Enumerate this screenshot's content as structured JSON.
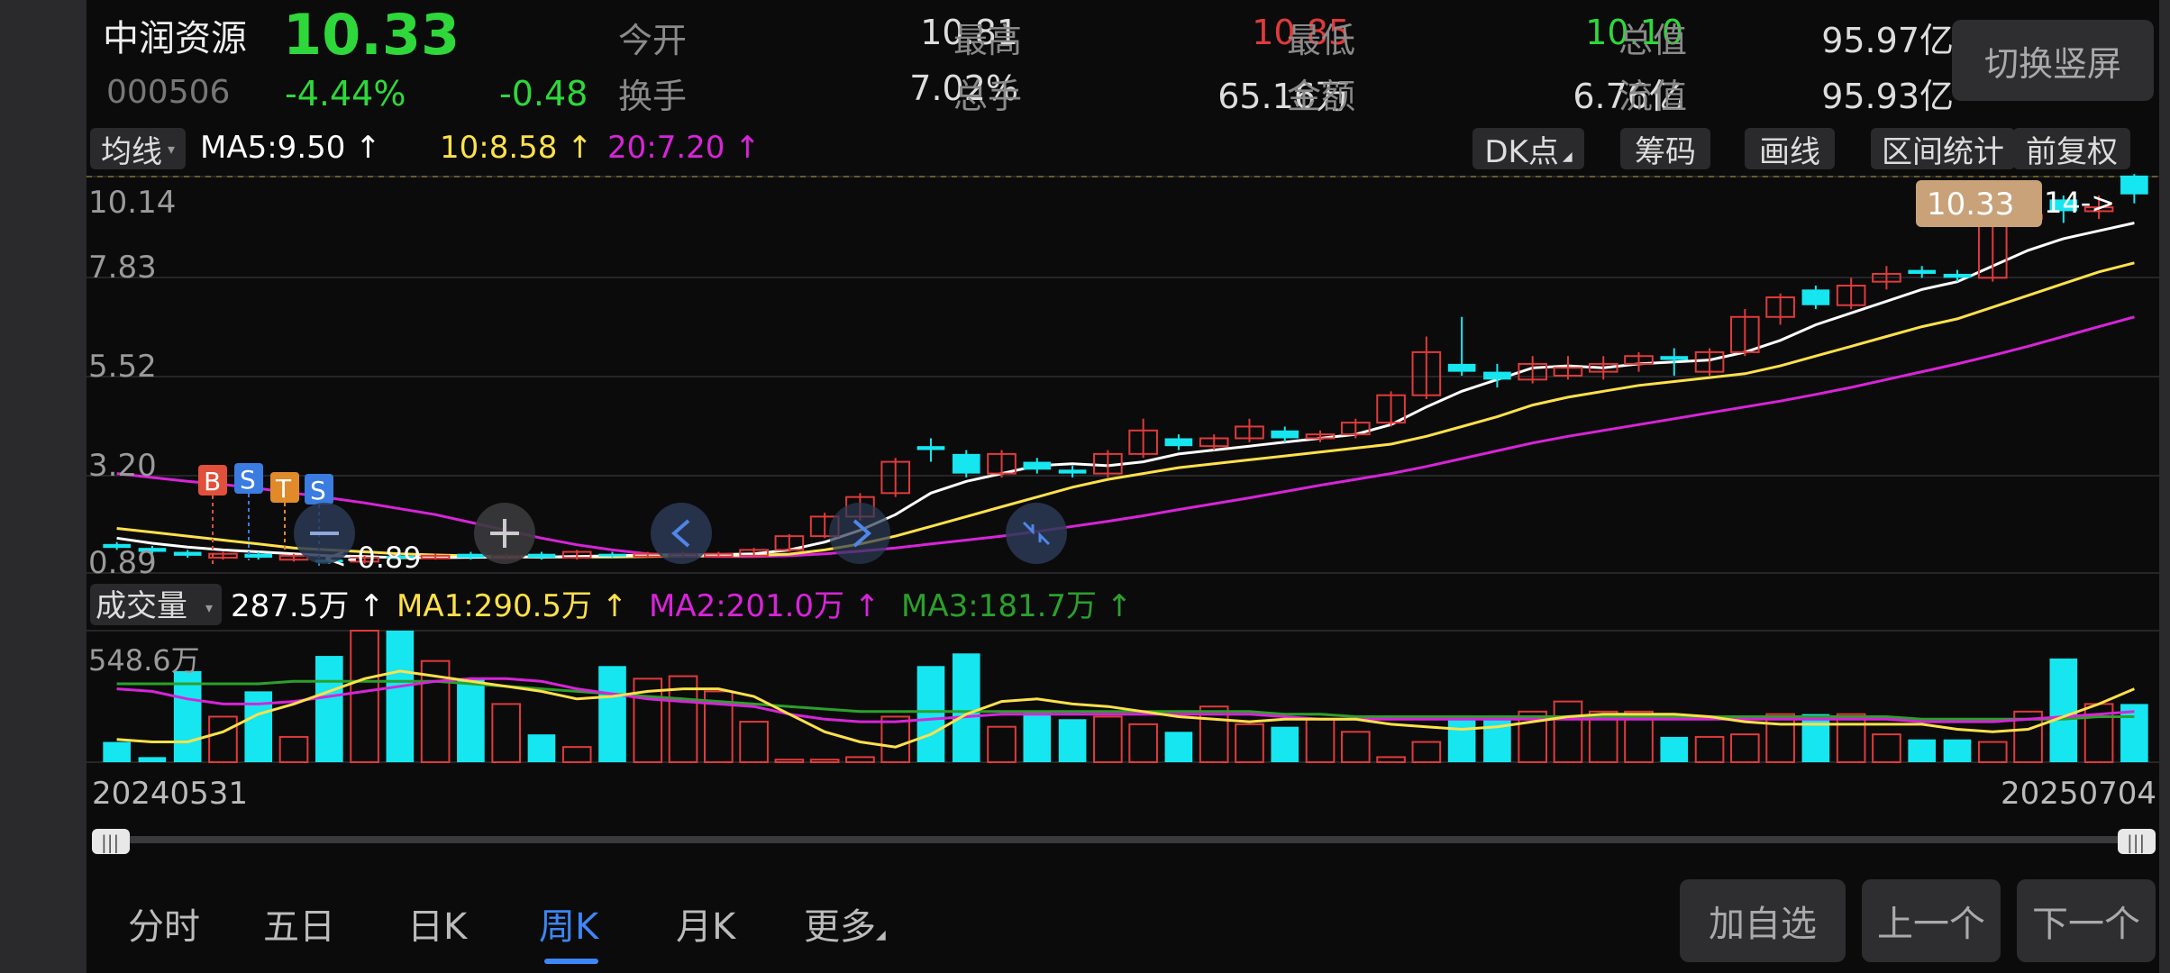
{
  "header": {
    "name": "中润资源",
    "code": "000506",
    "price": "10.33",
    "change_pct": "-4.44%",
    "change_abs": "-0.48",
    "stats": [
      {
        "label": "今开",
        "value": "10.81"
      },
      {
        "label": "最高",
        "value": "10.85"
      },
      {
        "label": "最低",
        "value": "10.10"
      },
      {
        "label": "总值",
        "value": "95.97亿"
      },
      {
        "label": "换手",
        "value": "7.02%"
      },
      {
        "label": "总手",
        "value": "65.16万"
      },
      {
        "label": "金额",
        "value": "6.76亿"
      },
      {
        "label": "流值",
        "value": "95.93亿"
      }
    ],
    "switch_label": "切换竖屏"
  },
  "toolbar": {
    "ma_selector": "均线",
    "ma5": "MA5:9.50 ↑",
    "ma10": "10:8.58 ↑",
    "ma20": "20:7.20 ↑",
    "buttons": [
      "DK点",
      "筹码",
      "画线",
      "区间统计",
      "前复权"
    ]
  },
  "colors": {
    "up": "#e03a3a",
    "down": "#16e6f0",
    "ma5": "#ffffff",
    "ma10": "#ffe14a",
    "ma20": "#d824d8",
    "vol_ma3": "#2ca02c",
    "accent": "#3d86f5",
    "price_green": "#2ed83a"
  },
  "price_axis": {
    "ticks": [
      "10.14",
      "7.83",
      "5.52",
      "3.20",
      "0.89"
    ]
  },
  "price_tag": "10.33",
  "max_marker": "14->",
  "min_marker": "<-0.89",
  "trade_markers": [
    "B",
    "S",
    "T",
    "S"
  ],
  "chart_controls": [
    "minus-icon",
    "plus-icon",
    "chevron-left-icon",
    "chevron-right-icon",
    "compress-icon"
  ],
  "volume": {
    "selector": "成交量",
    "current": "287.5万 ↑",
    "ma1": "MA1:290.5万 ↑",
    "ma2": "MA2:201.0万 ↑",
    "ma3": "MA3:181.7万 ↑",
    "axis_top": "548.6万"
  },
  "dates": {
    "start": "20240531",
    "end": "20250704"
  },
  "tabs": [
    {
      "label": "分时"
    },
    {
      "label": "五日"
    },
    {
      "label": "日K"
    },
    {
      "label": "周K",
      "active": true
    },
    {
      "label": "月K"
    },
    {
      "label": "更多"
    }
  ],
  "actions": [
    "加自选",
    "上一个",
    "下一个"
  ],
  "chart_data": {
    "type": "candlestick",
    "price_range": [
      0.89,
      10.14
    ],
    "candles": [
      [
        1.4,
        1.3,
        1.45,
        1.25
      ],
      [
        1.3,
        1.2,
        1.35,
        1.15
      ],
      [
        1.2,
        1.1,
        1.25,
        1.05
      ],
      [
        1.05,
        1.15,
        1.2,
        1.0
      ],
      [
        1.15,
        1.05,
        1.2,
        1.0
      ],
      [
        1.0,
        1.1,
        1.15,
        0.95
      ],
      [
        1.0,
        0.95,
        1.1,
        0.89
      ],
      [
        0.95,
        1.05,
        1.1,
        0.9
      ],
      [
        1.1,
        1.05,
        1.15,
        1.0
      ],
      [
        1.05,
        1.1,
        1.15,
        1.0
      ],
      [
        1.15,
        1.05,
        1.2,
        1.0
      ],
      [
        1.05,
        1.1,
        1.15,
        1.0
      ],
      [
        1.15,
        1.05,
        1.2,
        1.0
      ],
      [
        1.05,
        1.2,
        1.25,
        1.0
      ],
      [
        1.15,
        1.1,
        1.2,
        1.05
      ],
      [
        1.1,
        1.15,
        1.2,
        1.05
      ],
      [
        1.1,
        1.15,
        1.2,
        1.05
      ],
      [
        1.1,
        1.15,
        1.2,
        1.05
      ],
      [
        1.1,
        1.25,
        1.3,
        1.05
      ],
      [
        1.25,
        1.6,
        1.65,
        1.2
      ],
      [
        1.6,
        2.1,
        2.2,
        1.55
      ],
      [
        2.1,
        2.6,
        2.7,
        2.0
      ],
      [
        2.7,
        3.5,
        3.6,
        2.6
      ],
      [
        3.9,
        3.8,
        4.1,
        3.5
      ],
      [
        3.7,
        3.2,
        3.8,
        3.1
      ],
      [
        3.2,
        3.7,
        3.8,
        3.1
      ],
      [
        3.5,
        3.3,
        3.6,
        3.2
      ],
      [
        3.3,
        3.2,
        3.4,
        3.1
      ],
      [
        3.2,
        3.7,
        3.8,
        3.1
      ],
      [
        3.7,
        4.3,
        4.6,
        3.6
      ],
      [
        4.1,
        3.9,
        4.2,
        3.8
      ],
      [
        3.9,
        4.1,
        4.2,
        3.8
      ],
      [
        4.1,
        4.4,
        4.6,
        4.0
      ],
      [
        4.3,
        4.1,
        4.4,
        4.0
      ],
      [
        4.1,
        4.2,
        4.3,
        4.0
      ],
      [
        4.2,
        4.5,
        4.6,
        4.1
      ],
      [
        4.5,
        5.2,
        5.3,
        4.4
      ],
      [
        5.2,
        6.3,
        6.7,
        5.1
      ],
      [
        6.0,
        5.8,
        7.2,
        5.7
      ],
      [
        5.8,
        5.6,
        6.0,
        5.4
      ],
      [
        5.6,
        6.0,
        6.2,
        5.5
      ],
      [
        5.7,
        5.9,
        6.2,
        5.6
      ],
      [
        5.8,
        6.0,
        6.2,
        5.6
      ],
      [
        6.0,
        6.2,
        6.3,
        5.8
      ],
      [
        6.2,
        6.1,
        6.4,
        5.7
      ],
      [
        5.8,
        6.3,
        6.4,
        5.7
      ],
      [
        6.3,
        7.2,
        7.4,
        6.2
      ],
      [
        7.2,
        7.7,
        7.8,
        7.0
      ],
      [
        7.9,
        7.5,
        8.0,
        7.4
      ],
      [
        7.5,
        8.0,
        8.2,
        7.4
      ],
      [
        8.1,
        8.3,
        8.5,
        7.9
      ],
      [
        8.4,
        8.3,
        8.5,
        8.2
      ],
      [
        8.3,
        8.2,
        8.4,
        8.1
      ],
      [
        8.2,
        9.6,
        9.8,
        8.1
      ],
      [
        9.7,
        9.8,
        10.1,
        9.5
      ],
      [
        10.2,
        9.9,
        10.3,
        9.6
      ],
      [
        9.9,
        10.0,
        10.3,
        9.7
      ],
      [
        10.81,
        10.33,
        10.85,
        10.1
      ]
    ],
    "ma5": [
      1.55,
      1.42,
      1.32,
      1.25,
      1.2,
      1.15,
      1.1,
      1.08,
      1.05,
      1.05,
      1.06,
      1.07,
      1.07,
      1.08,
      1.1,
      1.12,
      1.13,
      1.13,
      1.15,
      1.25,
      1.45,
      1.75,
      2.15,
      2.7,
      3.0,
      3.2,
      3.4,
      3.45,
      3.4,
      3.5,
      3.7,
      3.8,
      3.9,
      4.0,
      4.1,
      4.2,
      4.45,
      4.9,
      5.3,
      5.6,
      5.9,
      5.95,
      5.9,
      6.0,
      6.05,
      6.1,
      6.3,
      6.6,
      7.0,
      7.3,
      7.6,
      7.9,
      8.1,
      8.5,
      8.9,
      9.2,
      9.4,
      9.6
    ],
    "ma10": [
      1.8,
      1.7,
      1.6,
      1.5,
      1.4,
      1.3,
      1.25,
      1.2,
      1.15,
      1.12,
      1.1,
      1.08,
      1.07,
      1.07,
      1.07,
      1.08,
      1.09,
      1.1,
      1.11,
      1.14,
      1.25,
      1.4,
      1.6,
      1.85,
      2.1,
      2.35,
      2.6,
      2.85,
      3.05,
      3.2,
      3.35,
      3.45,
      3.55,
      3.65,
      3.75,
      3.85,
      3.95,
      4.15,
      4.4,
      4.65,
      4.95,
      5.15,
      5.3,
      5.45,
      5.55,
      5.65,
      5.75,
      5.95,
      6.2,
      6.45,
      6.7,
      6.95,
      7.15,
      7.45,
      7.75,
      8.05,
      8.35,
      8.58
    ],
    "ma20": [
      3.2,
      3.1,
      3.0,
      2.92,
      2.82,
      2.7,
      2.58,
      2.45,
      2.3,
      2.15,
      1.95,
      1.75,
      1.55,
      1.38,
      1.25,
      1.15,
      1.1,
      1.08,
      1.08,
      1.1,
      1.15,
      1.22,
      1.3,
      1.4,
      1.5,
      1.6,
      1.72,
      1.85,
      1.98,
      2.12,
      2.28,
      2.43,
      2.58,
      2.74,
      2.9,
      3.05,
      3.2,
      3.38,
      3.58,
      3.78,
      3.98,
      4.15,
      4.3,
      4.45,
      4.6,
      4.75,
      4.9,
      5.05,
      5.22,
      5.4,
      5.6,
      5.8,
      6.0,
      6.22,
      6.45,
      6.7,
      6.95,
      7.2
    ],
    "volumes": [
      80,
      20,
      360,
      180,
      280,
      100,
      420,
      520,
      520,
      400,
      330,
      230,
      110,
      60,
      380,
      330,
      340,
      280,
      160,
      10,
      10,
      20,
      180,
      380,
      430,
      140,
      200,
      170,
      180,
      150,
      120,
      220,
      150,
      140,
      170,
      120,
      20,
      80,
      180,
      180,
      200,
      240,
      200,
      200,
      100,
      100,
      110,
      190,
      190,
      190,
      110,
      90,
      90,
      80,
      200,
      410,
      230,
      230
    ],
    "vol_ma1": [
      90,
      80,
      80,
      120,
      190,
      230,
      280,
      330,
      360,
      340,
      320,
      300,
      280,
      250,
      260,
      280,
      290,
      290,
      260,
      190,
      120,
      80,
      60,
      110,
      190,
      240,
      250,
      230,
      220,
      200,
      180,
      170,
      160,
      170,
      170,
      170,
      150,
      140,
      130,
      140,
      160,
      180,
      190,
      190,
      190,
      180,
      160,
      150,
      150,
      150,
      150,
      150,
      130,
      120,
      130,
      180,
      230,
      290
    ],
    "vol_ma2": [
      290,
      280,
      250,
      230,
      230,
      240,
      260,
      280,
      300,
      320,
      330,
      330,
      320,
      290,
      270,
      250,
      240,
      230,
      220,
      190,
      170,
      160,
      160,
      170,
      180,
      190,
      190,
      190,
      190,
      190,
      190,
      190,
      190,
      180,
      170,
      170,
      170,
      170,
      170,
      170,
      170,
      170,
      170,
      170,
      170,
      170,
      170,
      170,
      170,
      170,
      170,
      160,
      160,
      160,
      170,
      180,
      190,
      200
    ],
    "vol_ma3": [
      310,
      310,
      310,
      310,
      310,
      320,
      320,
      320,
      320,
      320,
      310,
      300,
      290,
      280,
      270,
      260,
      250,
      240,
      230,
      220,
      210,
      200,
      200,
      200,
      200,
      200,
      200,
      200,
      200,
      200,
      200,
      200,
      200,
      190,
      190,
      180,
      180,
      180,
      180,
      180,
      180,
      180,
      180,
      180,
      180,
      180,
      180,
      180,
      180,
      180,
      180,
      170,
      170,
      170,
      170,
      170,
      180,
      180
    ]
  }
}
